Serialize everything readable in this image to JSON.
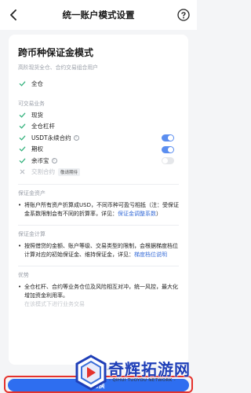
{
  "header": {
    "title": "统一账户模式设置",
    "back_icon": "chevron-left-icon",
    "help_icon": "help-circle-icon"
  },
  "mode": {
    "title": "跨币种保证金模式",
    "subtitle": "高阶现货全仓、合约交易组合用户",
    "margin_type": "全仓"
  },
  "business": {
    "label": "可交易业务",
    "items": [
      {
        "label": "现货",
        "type": "check"
      },
      {
        "label": "全仓杠杆",
        "type": "check"
      },
      {
        "label": "USDT永续合约",
        "type": "toggle",
        "on": true,
        "info": true
      },
      {
        "label": "期权",
        "type": "toggle",
        "on": true
      },
      {
        "label": "余币宝",
        "type": "toggle",
        "on": false,
        "info": true
      },
      {
        "label": "交割合约",
        "type": "disabled",
        "badge": "敬请期待"
      }
    ]
  },
  "assets": {
    "title": "保证金资产",
    "text": "将账户所有资产折算成USD，不同币种可盈亏相抵（注：受保证金系数限制会有不同的折算率，详见：",
    "link": "保证金调整系数",
    "tail": "）"
  },
  "calc": {
    "title": "保证金计算",
    "text": "按照借贷的金额、账户等级、交易类型的限制，会根据梯度档位计算对应的初始保证金、维持保证金，详见：",
    "link": "梯度档位说明"
  },
  "advantage": {
    "title": "优势",
    "text": "全仓杠杆、合约等业务仓位及风险相互对冲，统一风控，最大化增加资金利用率。",
    "text2": "在该模式下进行业务交易"
  },
  "footer": {
    "button": "切换"
  },
  "watermark": {
    "text": "奇辉拓游网",
    "sub": "- QIHUI TUOYOU NETWORK -"
  },
  "colors": {
    "accent": "#2e6ef0",
    "toggle_on": "#5b8ef0",
    "check": "#34b27d",
    "highlight_border": "#e5322d"
  }
}
